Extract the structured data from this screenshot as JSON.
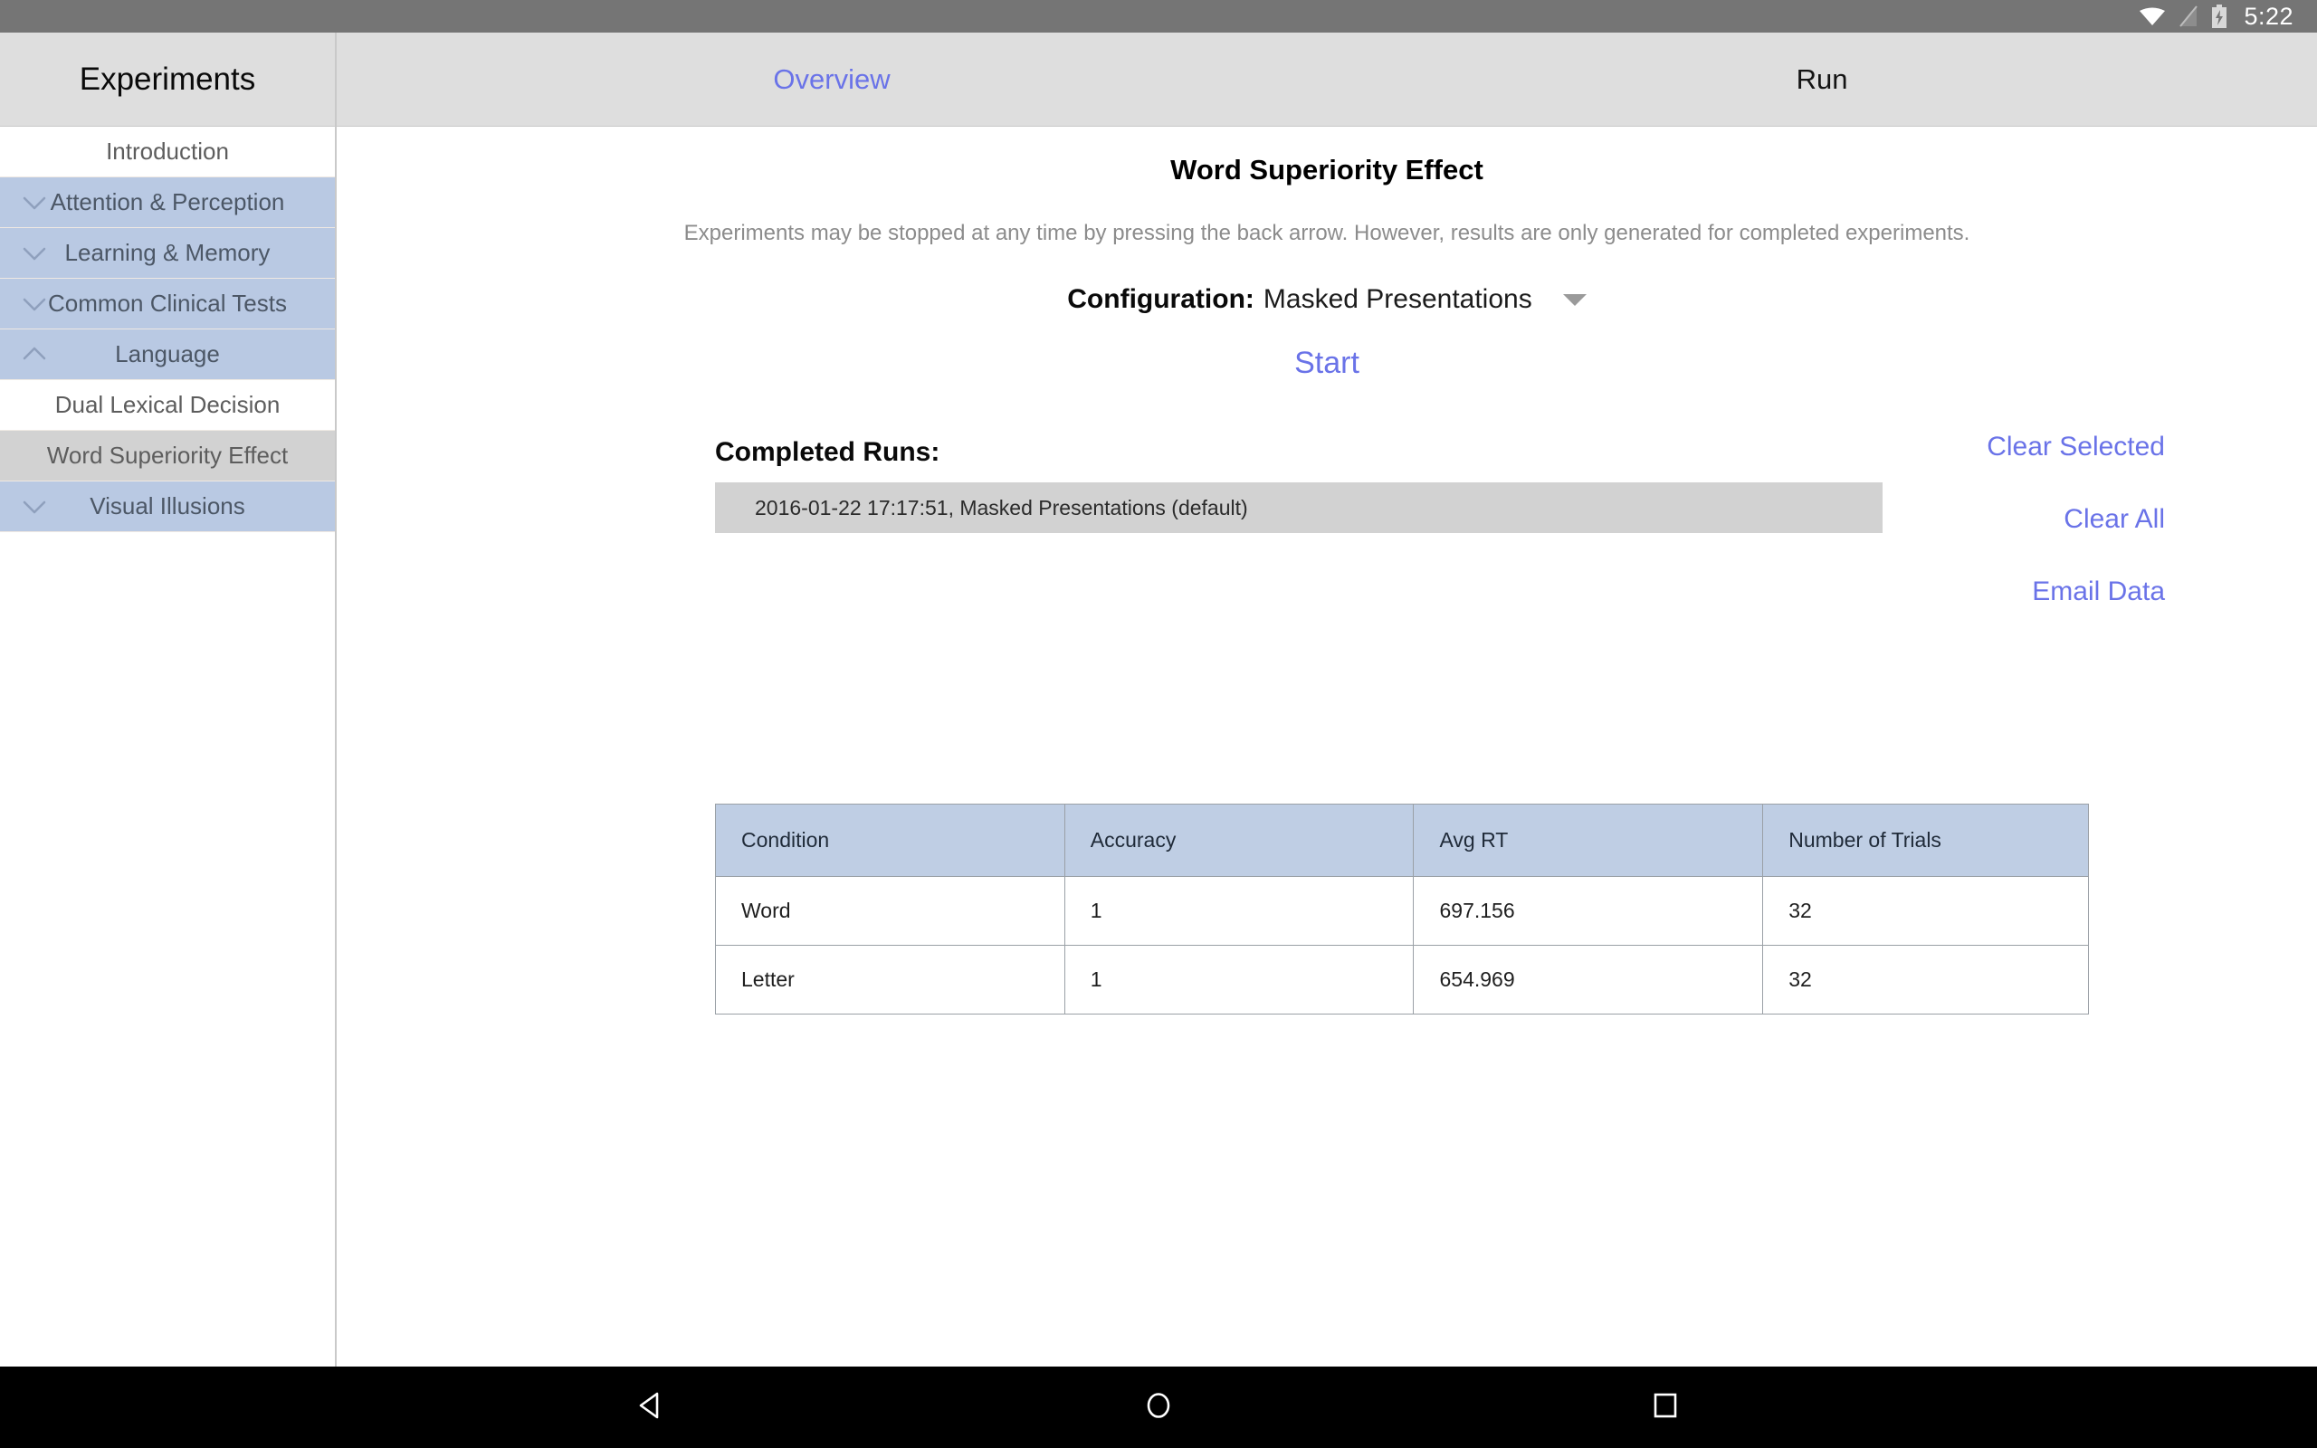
{
  "statusbar": {
    "time": "5:22",
    "icons": [
      "wifi-icon",
      "signal-off-icon",
      "battery-charging-icon"
    ]
  },
  "sidebar": {
    "header_title": "Experiments",
    "items": [
      {
        "label": "Introduction",
        "type": "plain",
        "chevron": "none",
        "selected": false
      },
      {
        "label": "Attention & Perception",
        "type": "group",
        "chevron": "down",
        "selected": false
      },
      {
        "label": "Learning & Memory",
        "type": "group",
        "chevron": "down",
        "selected": false
      },
      {
        "label": "Common Clinical Tests",
        "type": "group",
        "chevron": "down",
        "selected": false
      },
      {
        "label": "Language",
        "type": "group",
        "chevron": "up",
        "selected": false
      },
      {
        "label": "Dual Lexical Decision",
        "type": "child",
        "chevron": "none",
        "selected": false
      },
      {
        "label": "Word Superiority Effect",
        "type": "child",
        "chevron": "none",
        "selected": true
      },
      {
        "label": "Visual Illusions",
        "type": "group",
        "chevron": "down",
        "selected": false
      }
    ]
  },
  "tabs": [
    {
      "label": "Overview",
      "active": true
    },
    {
      "label": "Run",
      "active": false
    }
  ],
  "main": {
    "title": "Word Superiority Effect",
    "description": "Experiments may be stopped at any time by pressing the back arrow. However, results are only generated for completed experiments.",
    "config_label": "Configuration:",
    "config_value": "Masked Presentations",
    "start_label": "Start",
    "runs_title": "Completed Runs:",
    "runs": [
      "2016-01-22 17:17:51, Masked Presentations (default)"
    ],
    "actions": [
      "Clear Selected",
      "Clear All",
      "Email Data"
    ]
  },
  "results": {
    "headers": [
      "Condition",
      "Accuracy",
      "Avg RT",
      "Number of Trials"
    ],
    "rows": [
      [
        "Word",
        "1",
        "697.156",
        "32"
      ],
      [
        "Letter",
        "1",
        "654.969",
        "32"
      ]
    ]
  },
  "navbar": {
    "buttons": [
      "back-icon",
      "home-icon",
      "recents-icon"
    ]
  },
  "colors": {
    "accent": "#6a73e8",
    "group_bg": "#b9c9e3",
    "selected_bg": "#d2d2d2",
    "header_bg": "#dedede",
    "table_header_bg": "#bfcee4",
    "statusbar_bg": "#757575"
  }
}
